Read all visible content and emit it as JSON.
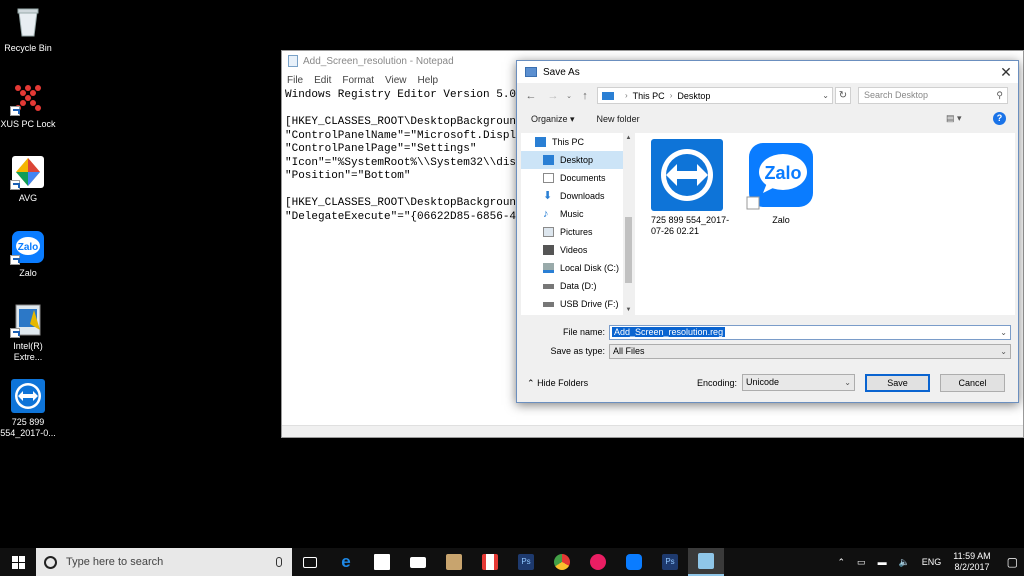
{
  "desktop": {
    "icons": [
      {
        "label": "Recycle Bin"
      },
      {
        "label": "XUS PC Lock"
      },
      {
        "label": "AVG"
      },
      {
        "label": "Zalo"
      },
      {
        "label": "Intel(R) Extre..."
      },
      {
        "label": "725 899 554_2017-0..."
      }
    ]
  },
  "notepad": {
    "title": "Add_Screen_resolution - Notepad",
    "menu": [
      "File",
      "Edit",
      "Format",
      "View",
      "Help"
    ],
    "content": "Windows Registry Editor Version 5.00\n\n[HKEY_CLASSES_ROOT\\DesktopBackground\\Sh\n\"ControlPanelName\"=\"Microsoft.Display\"\n\"ControlPanelPage\"=\"Settings\"\n\"Icon\"=\"%SystemRoot%\\\\System32\\\\display\n\"Position\"=\"Bottom\"\n\n[HKEY_CLASSES_ROOT\\DesktopBackground\\Sh\n\"DelegateExecute\"=\"{06622D85-6856-4460-"
  },
  "saveas": {
    "title": "Save As",
    "address": {
      "root": "This PC",
      "current": "Desktop"
    },
    "search_placeholder": "Search Desktop",
    "organize_label": "Organize ▾",
    "new_folder_label": "New folder",
    "nav_items": [
      {
        "label": "This PC",
        "icon": "computer-icon",
        "color": "#2a7fd4"
      },
      {
        "label": "Desktop",
        "icon": "desktop-folder-icon",
        "color": "#2a7fd4"
      },
      {
        "label": "Documents",
        "icon": "documents-icon",
        "color": "#8a8a8a"
      },
      {
        "label": "Downloads",
        "icon": "downloads-icon",
        "color": "#2a7fd4"
      },
      {
        "label": "Music",
        "icon": "music-icon",
        "color": "#2a7fd4"
      },
      {
        "label": "Pictures",
        "icon": "pictures-icon",
        "color": "#8a8a8a"
      },
      {
        "label": "Videos",
        "icon": "videos-icon",
        "color": "#555555"
      },
      {
        "label": "Local Disk (C:)",
        "icon": "drive-icon",
        "color": "#777777"
      },
      {
        "label": "Data (D:)",
        "icon": "drive-icon",
        "color": "#555555"
      },
      {
        "label": "USB Drive (F:)",
        "icon": "usb-drive-icon",
        "color": "#555555"
      }
    ],
    "files": [
      {
        "name": "725 899 554_2017-07-26 02.21",
        "icon": "teamviewer-icon"
      },
      {
        "name": "Zalo",
        "icon": "zalo-icon"
      }
    ],
    "file_name_label": "File name:",
    "file_name_value": "Add_Screen_resolution.reg",
    "save_type_label": "Save as type:",
    "save_type_value": "All Files",
    "hide_folders_label": "Hide Folders",
    "encoding_label": "Encoding:",
    "encoding_value": "Unicode",
    "save_label": "Save",
    "cancel_label": "Cancel"
  },
  "taskbar": {
    "search_placeholder": "Type here to search",
    "apps": [
      {
        "icon": "task-view-icon",
        "color": "#ffffff"
      },
      {
        "icon": "edge-icon",
        "color": "#1e88e5"
      },
      {
        "icon": "store-icon",
        "color": "#ffffff"
      },
      {
        "icon": "mail-icon",
        "color": "#ffffff"
      },
      {
        "icon": "app-icon",
        "color": "#c8a46e"
      },
      {
        "icon": "gmail-icon",
        "color": "#e53935"
      },
      {
        "icon": "photoshop-icon",
        "color": "#1e3a6e"
      },
      {
        "icon": "chrome-icon",
        "color": "#43a047"
      },
      {
        "icon": "app-pink-icon",
        "color": "#e91e63"
      },
      {
        "icon": "zalo-icon",
        "color": "#0a7cff"
      },
      {
        "icon": "photoshop-icon",
        "color": "#1e3a6e"
      },
      {
        "icon": "notepad-icon",
        "color": "#8fc6e8"
      }
    ],
    "language": "ENG",
    "time": "11:59 AM",
    "date": "8/2/2017"
  }
}
